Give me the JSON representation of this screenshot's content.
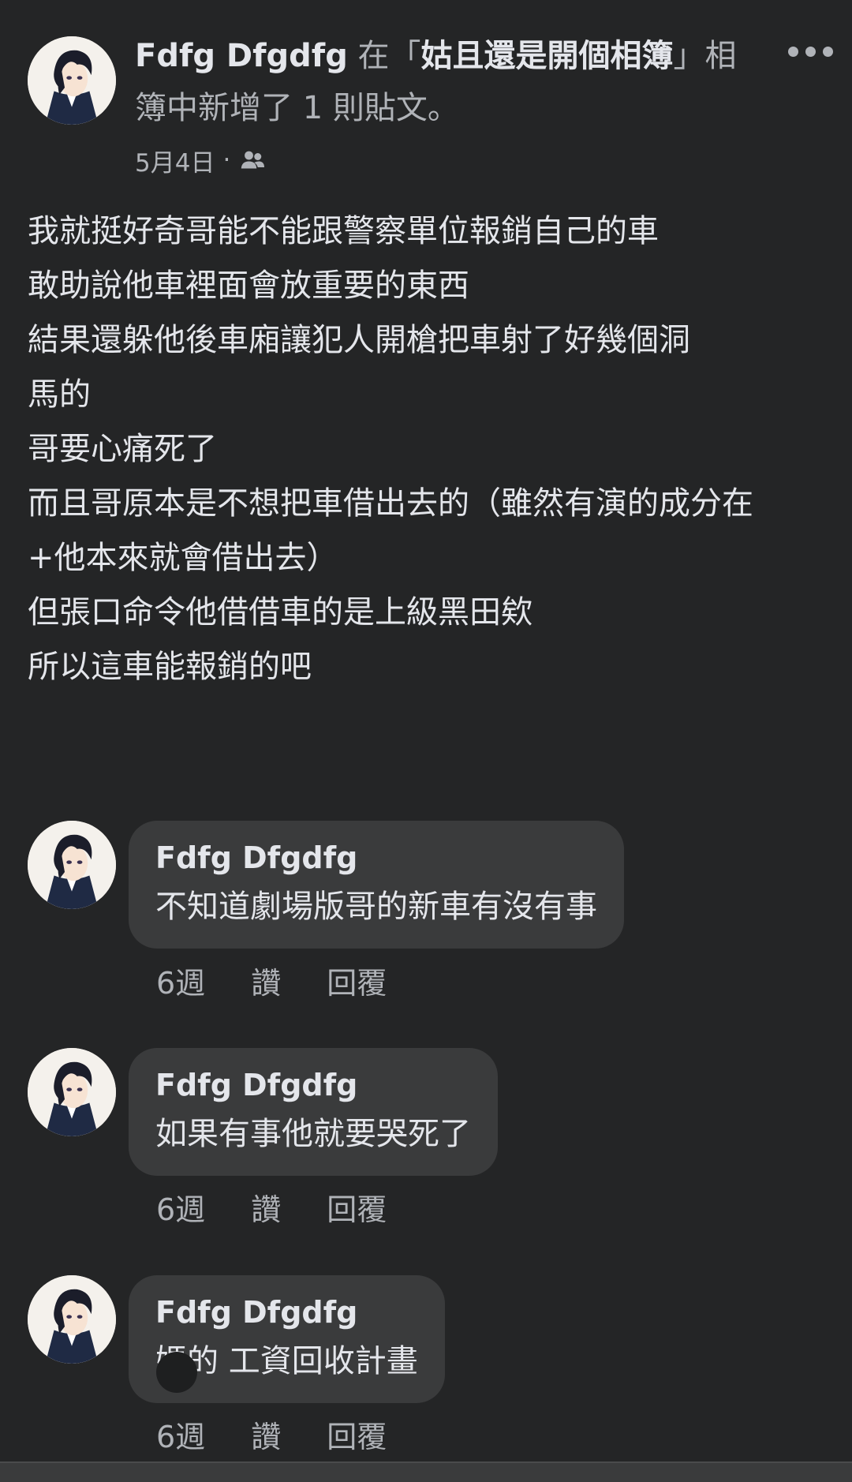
{
  "post": {
    "author": "Fdfg Dfgdfg",
    "action_prefix": " 在「",
    "album": "姑且還是開個相簿",
    "action_suffix": "」相簿中新增了 1 則貼文。",
    "date": "5月4日",
    "separator": "·",
    "audience_icon": "friends-icon",
    "more_icon": "more-horizontal-icon",
    "body_lines": [
      "我就挺好奇哥能不能跟警察單位報銷自己的車",
      "敢助說他車裡面會放重要的東西",
      "結果還躲他後車廂讓犯人開槍把車射了好幾個洞",
      "馬的",
      "哥要心痛死了",
      "而且哥原本是不想把車借出去的（雖然有演的成分在",
      "+他本來就會借出去）",
      "但張口命令他借借車的是上級黑田欸",
      "所以這車能報銷的吧"
    ]
  },
  "comments": [
    {
      "author": "Fdfg Dfgdfg",
      "text": "不知道劇場版哥的新車有沒有事",
      "time": "6週",
      "like": "讚",
      "reply": "回覆"
    },
    {
      "author": "Fdfg Dfgdfg",
      "text": "如果有事他就要哭死了",
      "time": "6週",
      "like": "讚",
      "reply": "回覆"
    },
    {
      "author": "Fdfg Dfgdfg",
      "text": "媽的 工資回收計畫",
      "time": "6週",
      "like": "讚",
      "reply": "回覆"
    }
  ],
  "colors": {
    "background": "#242526",
    "bubble": "#3a3b3c",
    "primary_text": "#e4e6eb",
    "secondary_text": "#b0b3b8"
  }
}
